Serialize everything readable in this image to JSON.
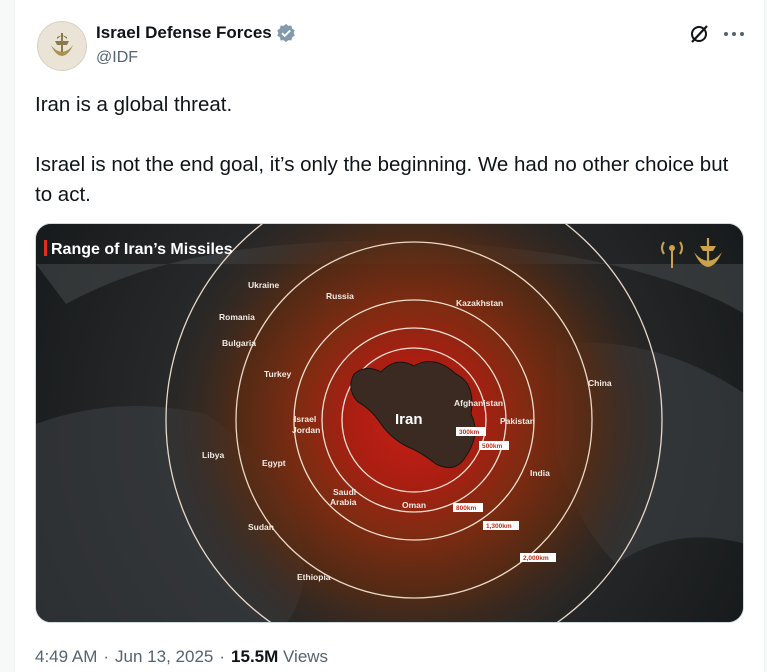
{
  "author": {
    "name": "Israel Defense Forces",
    "handle": "@IDF",
    "verified_color": "#829aab"
  },
  "tweet": {
    "line1": "Iran is a global threat.",
    "line2": "Israel is not the end goal, it’s only the beginning. We had no other choice but to act."
  },
  "media": {
    "title": "Range of Iran’s Missiles",
    "center_label": "Iran",
    "countries": {
      "ukraine": "Ukraine",
      "russia": "Russia",
      "kazakhstan": "Kazakhstan",
      "romania": "Romania",
      "bulgaria": "Bulgaria",
      "turkey": "Turkey",
      "israel": "Israel",
      "jordan": "Jordan",
      "libya": "Libya",
      "egypt": "Egypt",
      "saudi": "Saudi",
      "arabia": "Arabia",
      "oman": "Oman",
      "afghanistan": "Afghanistan",
      "pakistan": "Pakistan",
      "india": "India",
      "china": "China",
      "sudan": "Sudan",
      "ethiopia": "Ethiopia"
    },
    "ranges": [
      "300km",
      "500km",
      "800km",
      "1,300km",
      "2,000km"
    ]
  },
  "meta": {
    "time": "4:49 AM",
    "date": "Jun 13, 2025",
    "views_count": "15.5M",
    "views_label": "Views",
    "sep": "·"
  },
  "icons": [
    "verified-badge-icon",
    "grok-icon",
    "more-icon",
    "idf-emblem-icon",
    "antenna-icon"
  ]
}
